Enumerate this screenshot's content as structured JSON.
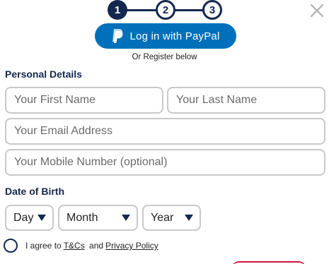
{
  "stepper": {
    "steps": [
      "1",
      "2",
      "3"
    ],
    "active_step": 1,
    "color": "#13284f"
  },
  "paypal": {
    "label": "Log in with PayPal",
    "icon": "paypal-logo-icon",
    "color": "#0070ba"
  },
  "register_note": "Or Register below",
  "personal": {
    "title": "Personal Details",
    "first_name_placeholder": "Your First Name",
    "last_name_placeholder": "Your Last Name",
    "email_placeholder": "Your Email Address",
    "mobile_placeholder": "Your Mobile Number (optional)"
  },
  "dob": {
    "title": "Date of Birth",
    "day": "Day",
    "month": "Month",
    "year": "Year"
  },
  "agree": {
    "prefix": "I agree to",
    "terms_link": "T&Cs",
    "and": "and",
    "privacy_link": "Privacy Policy"
  },
  "colors": {
    "brand_navy": "#13284f",
    "submit_accent": "#d4113f"
  }
}
